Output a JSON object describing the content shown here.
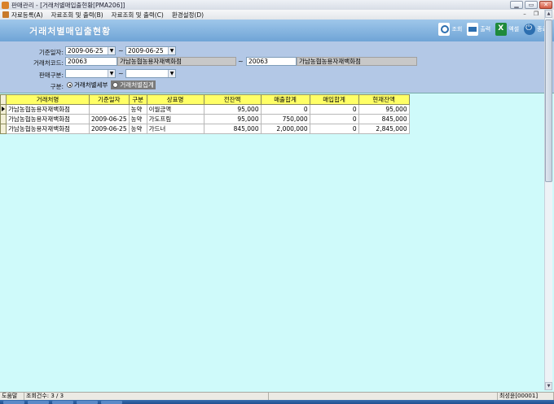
{
  "window": {
    "title": "판매관리 - [거래처별매입출현황[PMA206]]"
  },
  "menu": {
    "items": [
      "자료등록(A)",
      "자료조회 및 출력(B)",
      "자료조회 및 출력(C)",
      "환경설정(D)"
    ]
  },
  "form": {
    "title": "거래처별매입출현황"
  },
  "toolbar": {
    "search": "조회",
    "print": "출력",
    "excel": "엑셀",
    "exit": "종료"
  },
  "filters": {
    "date_label": "기준일자:",
    "date_from": "2009-06-25",
    "date_to": "2009-06-25",
    "client_label": "거래처코드:",
    "client_from_code": "20063",
    "client_from_name": "가남농협농용자재백화점",
    "client_to_code": "20063",
    "client_to_name": "가남농협농용자재백화점",
    "sales_label": "판매구분:",
    "sales_from": "",
    "sales_to": "",
    "tilde": "~",
    "type_label": "구분:",
    "type_option1": "거래처별세부",
    "type_option2": "거래처별집계"
  },
  "grid": {
    "columns": [
      "거래처명",
      "기준일자",
      "구분",
      "상표명",
      "전잔액",
      "매출합계",
      "매입합계",
      "현재잔액"
    ],
    "rows": [
      [
        "가남농협농용자재백화점",
        "",
        "농약",
        "이월금액",
        "95,000",
        "0",
        "0",
        "95,000"
      ],
      [
        "가남농협농용자재백화점",
        "2009-06-25",
        "농약",
        "가도프림",
        "95,000",
        "750,000",
        "0",
        "845,000"
      ],
      [
        "가남농협농용자재백화점",
        "2009-06-25",
        "농약",
        "가드너",
        "845,000",
        "2,000,000",
        "0",
        "2,845,000"
      ]
    ]
  },
  "status": {
    "mode": "도움말",
    "count": "조회건수: 3 / 3",
    "user": "최성윤[00001]"
  }
}
